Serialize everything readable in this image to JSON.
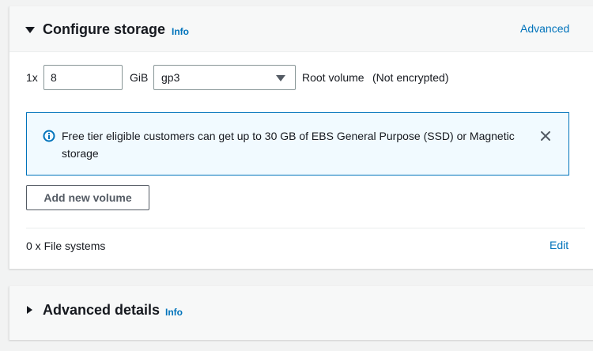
{
  "storage": {
    "title": "Configure storage",
    "info_label": "Info",
    "advanced_label": "Advanced",
    "volume_count": "1x",
    "volume_size": "8",
    "size_unit": "GiB",
    "volume_type": "gp3",
    "root_volume_label": "Root volume",
    "encryption_status": "(Not encrypted)",
    "alert_text": "Free tier eligible customers can get up to 30 GB of EBS General Purpose (SSD) or Magnetic storage",
    "add_volume_label": "Add new volume",
    "file_systems_label": "0 x File systems",
    "edit_label": "Edit"
  },
  "advanced": {
    "title": "Advanced details",
    "info_label": "Info"
  },
  "colors": {
    "link": "#0073bb",
    "alert_background": "#f1faff",
    "alert_border": "#0073bb",
    "panel_header": "#f7f8f8",
    "page_background": "#f2f3f3"
  },
  "icons": {
    "alert": "info-circle-icon",
    "dismiss": "close-icon",
    "expanded": "caret-down-icon",
    "collapsed": "caret-right-icon",
    "select": "select-caret-icon"
  }
}
